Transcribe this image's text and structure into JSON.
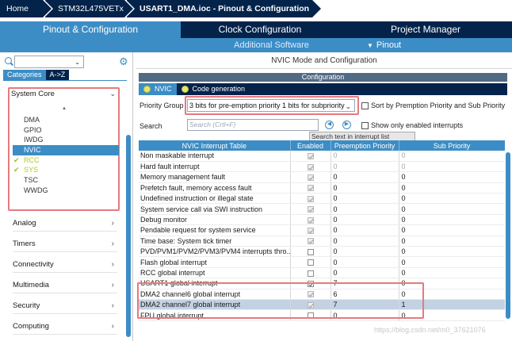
{
  "breadcrumb": [
    "Home",
    "STM32L475VETx",
    "USART1_DMA.ioc - Pinout & Configuration"
  ],
  "tabs": [
    "Pinout & Configuration",
    "Clock Configuration",
    "Project Manager"
  ],
  "subbar": {
    "additional_software": "Additional Software",
    "pinout": "Pinout",
    "pinout_icon": "chevron-down-icon"
  },
  "left": {
    "search_value": "",
    "category_tabs": [
      "Categories",
      "A->Z"
    ],
    "system_core": {
      "label": "System Core",
      "items": [
        {
          "label": "DMA",
          "checked": false
        },
        {
          "label": "GPIO",
          "checked": false
        },
        {
          "label": "IWDG",
          "checked": false
        },
        {
          "label": "NVIC",
          "checked": false,
          "selected": true
        },
        {
          "label": "RCC",
          "checked": true
        },
        {
          "label": "SYS",
          "checked": true
        },
        {
          "label": "TSC",
          "checked": false
        },
        {
          "label": "WWDG",
          "checked": false
        }
      ]
    },
    "categories": [
      "Analog",
      "Timers",
      "Connectivity",
      "Multimedia",
      "Security",
      "Computing"
    ]
  },
  "right": {
    "title": "NVIC Mode and Configuration",
    "configuration": "Configuration",
    "tabs": [
      "NVIC",
      "Code generation"
    ],
    "priority_group_label": "Priority Group",
    "priority_group_value": "3 bits for pre-emption priority 1 bits for subpriority",
    "sort_label": "Sort by Premption Priority and Sub Priority",
    "search_label": "Search",
    "search_placeholder": "Search (Crtl+F)",
    "show_enabled_label": "Show only enabled interrupts",
    "tooltip": "Search text in interrupt list",
    "columns": [
      "NVIC Interrupt Table",
      "Enabled",
      "Preemption Priority",
      "Sub Priority"
    ],
    "rows": [
      {
        "name": "Non maskable interrupt",
        "enabled": true,
        "locked": true,
        "pre": "0",
        "sub": "0",
        "dim": true
      },
      {
        "name": "Hard fault interrupt",
        "enabled": true,
        "locked": true,
        "pre": "0",
        "sub": "0",
        "dim": true
      },
      {
        "name": "Memory management fault",
        "enabled": true,
        "locked": true,
        "pre": "0",
        "sub": "0"
      },
      {
        "name": "Prefetch fault, memory access fault",
        "enabled": true,
        "locked": true,
        "pre": "0",
        "sub": "0"
      },
      {
        "name": "Undefined instruction or illegal state",
        "enabled": true,
        "locked": true,
        "pre": "0",
        "sub": "0"
      },
      {
        "name": "System service call via SWI instruction",
        "enabled": true,
        "locked": true,
        "pre": "0",
        "sub": "0"
      },
      {
        "name": "Debug monitor",
        "enabled": true,
        "locked": true,
        "pre": "0",
        "sub": "0"
      },
      {
        "name": "Pendable request for system service",
        "enabled": true,
        "locked": true,
        "pre": "0",
        "sub": "0"
      },
      {
        "name": "Time base: System tick timer",
        "enabled": true,
        "locked": true,
        "pre": "0",
        "sub": "0"
      },
      {
        "name": "PVD/PVM1/PVM2/PVM3/PVM4 interrupts thro...",
        "enabled": false,
        "locked": false,
        "pre": "0",
        "sub": "0"
      },
      {
        "name": "Flash global interrupt",
        "enabled": false,
        "locked": false,
        "pre": "0",
        "sub": "0"
      },
      {
        "name": "RCC global interrupt",
        "enabled": false,
        "locked": false,
        "pre": "0",
        "sub": "0"
      },
      {
        "name": "USART1 global interrupt",
        "enabled": true,
        "locked": false,
        "pre": "7",
        "sub": "0"
      },
      {
        "name": "DMA2 channel6 global interrupt",
        "enabled": true,
        "locked": true,
        "pre": "6",
        "sub": "0"
      },
      {
        "name": "DMA2 channel7 global interrupt",
        "enabled": true,
        "locked": true,
        "pre": "7",
        "sub": "1",
        "selected": true
      },
      {
        "name": "FPU global interrupt",
        "enabled": false,
        "locked": false,
        "pre": "0",
        "sub": "0"
      }
    ]
  },
  "watermark": "https://blog.csdn.net/m0_37621076",
  "colors": {
    "navy": "#03234b",
    "accent": "#3c8dc5",
    "highlight": "#e57a7e",
    "selected_row": "#c3d2e2"
  }
}
